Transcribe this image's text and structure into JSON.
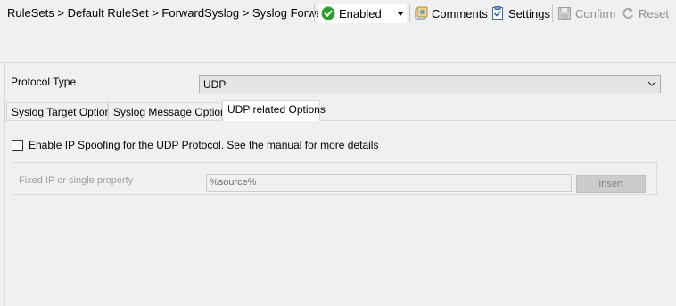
{
  "toolbar": {
    "breadcrumb": "RuleSets > Default RuleSet > ForwardSyslog > Syslog Forwarding",
    "status": {
      "value": "Enabled",
      "icon": "check-circle-icon",
      "color": "#2e9e2e"
    },
    "comments_label": "Comments",
    "settings_label": "Settings",
    "confirm_label": "Confirm",
    "reset_label": "Reset"
  },
  "protocol": {
    "label": "Protocol Type",
    "value": "UDP"
  },
  "tabs": [
    {
      "label": "Syslog Target Options",
      "active": false
    },
    {
      "label": "Syslog Message Options",
      "active": false
    },
    {
      "label": "UDP related Options",
      "active": true
    }
  ],
  "udp_options": {
    "spoof_label": "Enable IP Spoofing for the UDP Protocol. See the manual for more details",
    "spoof_checked": false,
    "fixed_ip_label": "Fixed IP or single property",
    "fixed_ip_value": "%source%",
    "insert_label": "Insert"
  }
}
